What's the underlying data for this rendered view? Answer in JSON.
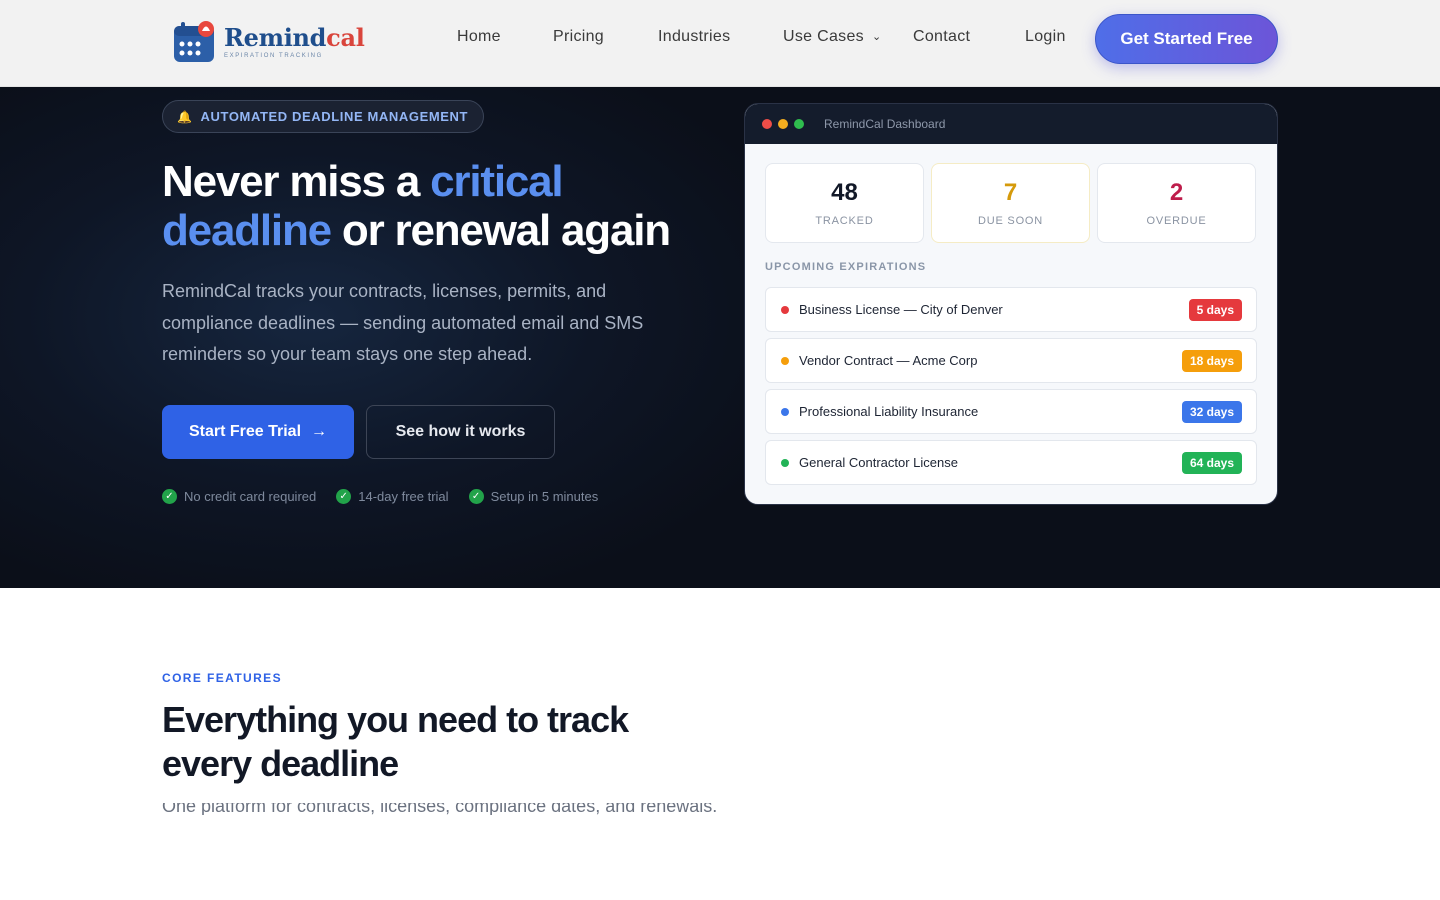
{
  "nav": {
    "logo_name_a": "Remind",
    "logo_name_b": "cal",
    "logo_sub": "EXPIRATION TRACKING",
    "items": [
      "Home",
      "Pricing",
      "Industries",
      "Use Cases",
      "Contact",
      "Login"
    ],
    "use_cases_has_dropdown": true,
    "cta": "Get Started Free"
  },
  "hero": {
    "badge": "AUTOMATED DEADLINE MANAGEMENT",
    "title_1": "Never miss a ",
    "title_hl": "critical deadline",
    "title_2": " or renewal again",
    "lead": "RemindCal tracks your contracts, licenses, permits, and compliance deadlines — sending automated email and SMS reminders so your team stays one step ahead.",
    "primary_button": "Start Free Trial",
    "secondary_button": "See how it works",
    "checks": [
      "No credit card required",
      "14-day free trial",
      "Setup in 5 minutes"
    ]
  },
  "dashboard": {
    "title": "RemindCal Dashboard",
    "stats": [
      {
        "value": "48",
        "label": "TRACKED",
        "color": "#111827"
      },
      {
        "value": "7",
        "label": "DUE SOON",
        "color": "#d59a0b"
      },
      {
        "value": "2",
        "label": "OVERDUE",
        "color": "#be1d4b"
      }
    ],
    "section_label": "UPCOMING EXPIRATIONS",
    "items": [
      {
        "name": "Business License — City of Denver",
        "due": "5 days",
        "color": "#e5393d"
      },
      {
        "name": "Vendor Contract — Acme Corp",
        "due": "18 days",
        "color": "#f59e0b"
      },
      {
        "name": "Professional Liability Insurance",
        "due": "32 days",
        "color": "#3b76ea"
      },
      {
        "name": "General Contractor License",
        "due": "64 days",
        "color": "#22b357"
      }
    ]
  },
  "features": {
    "eyebrow": "CORE FEATURES",
    "title": "Everything you need to track every deadline",
    "subtitle_partial": "One platform for contracts, licenses, compliance dates, and renewals."
  },
  "colors": {
    "accent": "#2f62e6",
    "hero_bg": "#0b0f19",
    "highlight": "#5a8ff0"
  }
}
